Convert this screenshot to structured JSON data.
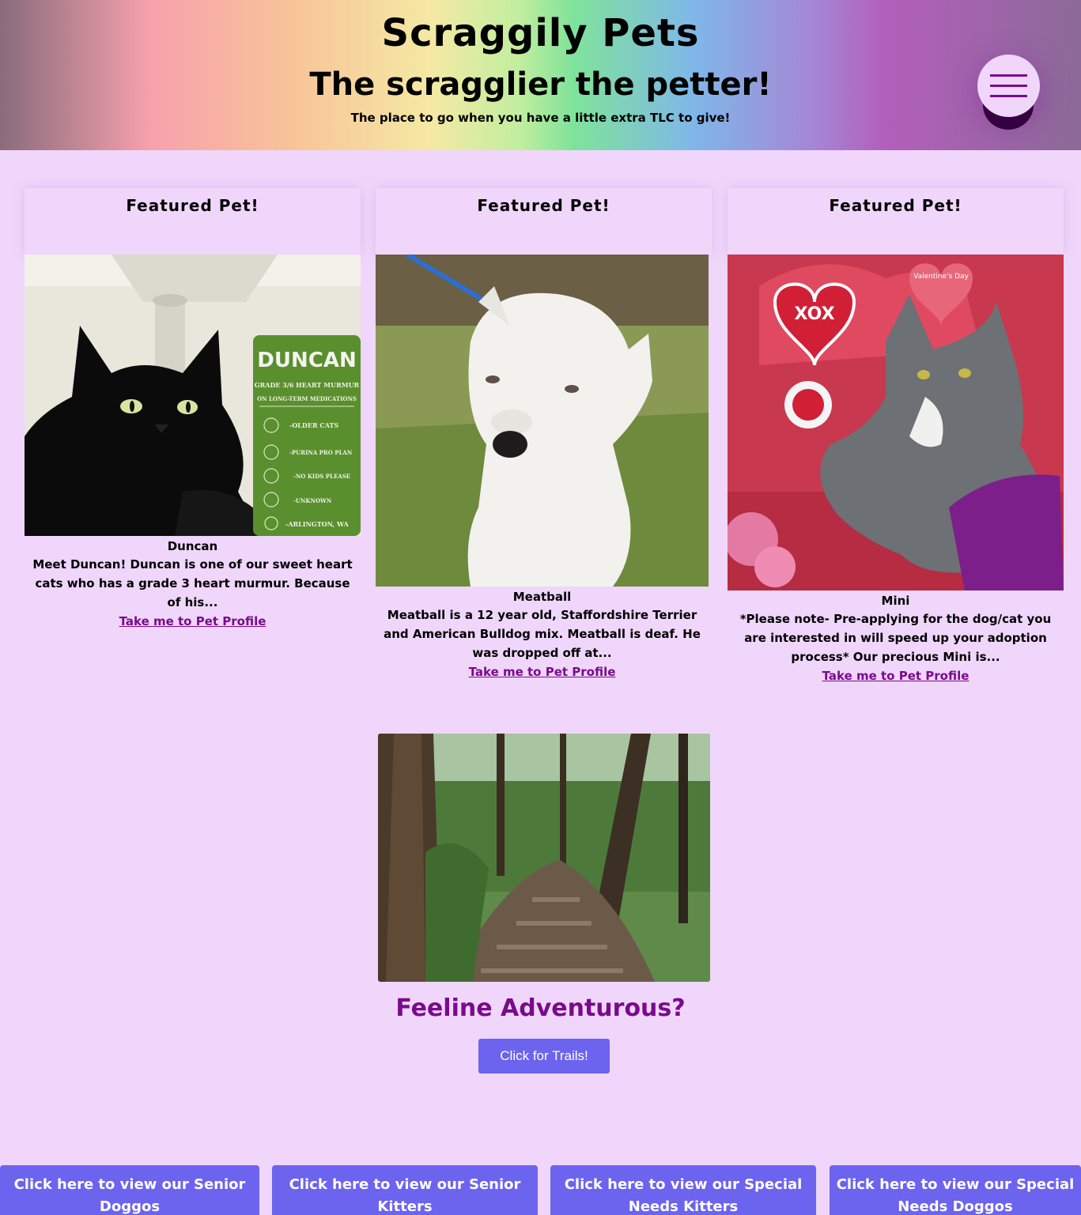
{
  "header": {
    "site_title": "Scraggily Pets",
    "tagline": "The scragglier the petter!",
    "subtagline": "The place to go when you have a little extra TLC to give!",
    "menu_icon": "hamburger-menu-icon"
  },
  "featured": [
    {
      "heading": "Featured Pet!",
      "name": "Duncan",
      "description": "Meet Duncan! Duncan is one of our sweet heart cats who has a grade 3 heart murmur. Because of his...",
      "link_text": "Take me to Pet Profile",
      "image_sign": {
        "title": "DUNCAN",
        "line1": "GRADE 3/6 HEART MURMUR",
        "line2": "ON LONG-TERM MEDICATIONS",
        "items": [
          "-OLDER CATS",
          "-PURINA PRO PLAN",
          "-NO KIDS PLEASE",
          "-UNKNOWN",
          "-ARLINGTON, WA"
        ]
      }
    },
    {
      "heading": "Featured Pet!",
      "name": "Meatball",
      "description": "Meatball is a 12 year old, Staffordshire Terrier and American Bulldog mix. Meatball is deaf. He was dropped off at...",
      "link_text": "Take me to Pet Profile"
    },
    {
      "heading": "Featured Pet!",
      "name": "Mini",
      "description": "*Please note- Pre-applying for the dog/cat you are interested in will speed up your adoption process* Our precious Mini is...",
      "link_text": "Take me to Pet Profile",
      "image_text": {
        "heart": "XOX",
        "valentine": "Valentine's Day"
      }
    }
  ],
  "adventure": {
    "heading": "Feeline Adventurous?",
    "button": "Click for Trails!"
  },
  "bottom_buttons": [
    "Click here to view our Senior Doggos",
    "Click here to view our Senior Kitters",
    "Click here to view our Special Needs Kitters",
    "Click here to view our Special Needs Doggos"
  ],
  "colors": {
    "background": "#f0d6fb",
    "accent_purple": "#7a0a8c",
    "button_blue": "#6c63ee"
  }
}
